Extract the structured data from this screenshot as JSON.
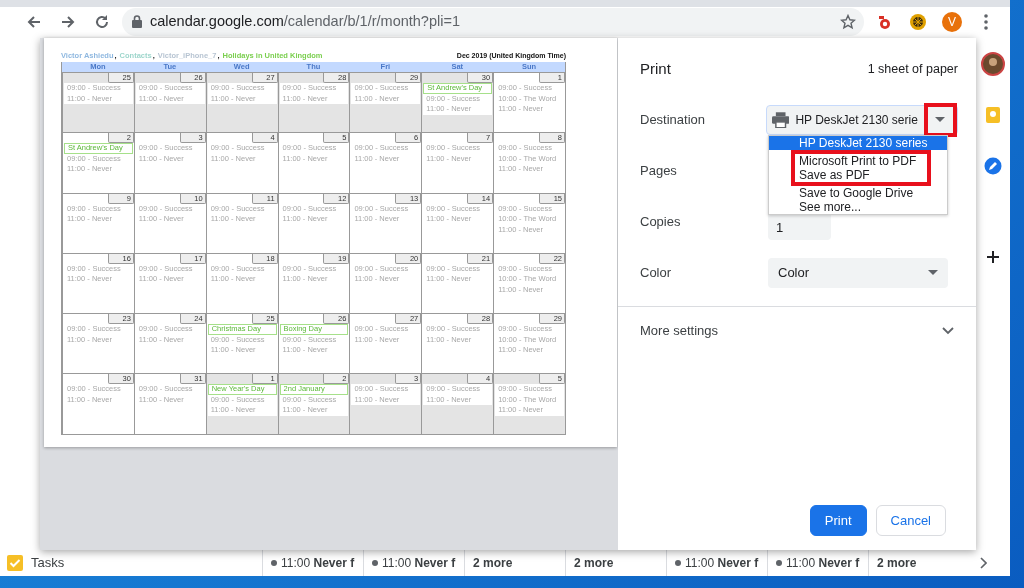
{
  "browser": {
    "url_host": "calendar.google.com",
    "url_path": "/calendar/b/1/r/month?pli=1",
    "avatar": "V"
  },
  "preview": {
    "calendars": [
      {
        "name": "Victor Ashiedu",
        "color": "#8fb8e0",
        "separator": ","
      },
      {
        "name": "Contacts",
        "color": "#9ed6cc",
        "separator": ","
      },
      {
        "name": "Victor_iPhone_7",
        "color": "#b7c4d2",
        "separator": ","
      },
      {
        "name": "Holidays in United Kingdom",
        "color": "#7bcf4f"
      }
    ],
    "title": "Dec 2019 (United Kingdom Time)",
    "weekdays": [
      "Mon",
      "Tue",
      "Wed",
      "Thu",
      "Fri",
      "Sat",
      "Sun"
    ],
    "days": [
      {
        "date": "25",
        "outside": true,
        "events": [
          {
            "kind": "entry",
            "text": "09:00 - Success"
          },
          {
            "kind": "entry",
            "text": "11:00 - Never"
          }
        ]
      },
      {
        "date": "26",
        "outside": true,
        "events": [
          {
            "kind": "entry",
            "text": "09:00 - Success"
          },
          {
            "kind": "entry",
            "text": "11:00 - Never"
          }
        ]
      },
      {
        "date": "27",
        "outside": true,
        "events": [
          {
            "kind": "entry",
            "text": "09:00 - Success"
          },
          {
            "kind": "entry",
            "text": "11:00 - Never"
          }
        ]
      },
      {
        "date": "28",
        "outside": true,
        "events": [
          {
            "kind": "entry",
            "text": "09:00 - Success"
          },
          {
            "kind": "entry",
            "text": "11:00 - Never"
          }
        ]
      },
      {
        "date": "29",
        "outside": true,
        "events": [
          {
            "kind": "entry",
            "text": "09:00 - Success"
          },
          {
            "kind": "entry",
            "text": "11:00 - Never"
          }
        ]
      },
      {
        "date": "30",
        "outside": true,
        "events": [
          {
            "kind": "holiday",
            "text": "St Andrew's Day"
          },
          {
            "kind": "entry",
            "text": "09:00 - Success"
          },
          {
            "kind": "entry",
            "text": "11:00 - Never"
          }
        ]
      },
      {
        "date": "1",
        "outside": false,
        "events": [
          {
            "kind": "entry",
            "text": "09:00 - Success"
          },
          {
            "kind": "entry",
            "text": "10:00 - The Word"
          },
          {
            "kind": "entry",
            "text": "11:00 - Never"
          }
        ]
      },
      {
        "date": "2",
        "outside": false,
        "events": [
          {
            "kind": "holiday",
            "text": "St Andrew's Day"
          },
          {
            "kind": "entry",
            "text": "09:00 - Success"
          },
          {
            "kind": "entry",
            "text": "11:00 - Never"
          }
        ]
      },
      {
        "date": "3",
        "outside": false,
        "events": [
          {
            "kind": "entry",
            "text": "09:00 - Success"
          },
          {
            "kind": "entry",
            "text": "11:00 - Never"
          }
        ]
      },
      {
        "date": "4",
        "outside": false,
        "events": [
          {
            "kind": "entry",
            "text": "09:00 - Success"
          },
          {
            "kind": "entry",
            "text": "11:00 - Never"
          }
        ]
      },
      {
        "date": "5",
        "outside": false,
        "events": [
          {
            "kind": "entry",
            "text": "09:00 - Success"
          },
          {
            "kind": "entry",
            "text": "11:00 - Never"
          }
        ]
      },
      {
        "date": "6",
        "outside": false,
        "events": [
          {
            "kind": "entry",
            "text": "09:00 - Success"
          },
          {
            "kind": "entry",
            "text": "11:00 - Never"
          }
        ]
      },
      {
        "date": "7",
        "outside": false,
        "events": [
          {
            "kind": "entry",
            "text": "09:00 - Success"
          },
          {
            "kind": "entry",
            "text": "11:00 - Never"
          }
        ]
      },
      {
        "date": "8",
        "outside": false,
        "events": [
          {
            "kind": "entry",
            "text": "09:00 - Success"
          },
          {
            "kind": "entry",
            "text": "10:00 - The Word"
          },
          {
            "kind": "entry",
            "text": "11:00 - Never"
          }
        ]
      },
      {
        "date": "9",
        "outside": false,
        "events": [
          {
            "kind": "entry",
            "text": "09:00 - Success"
          },
          {
            "kind": "entry",
            "text": "11:00 - Never"
          }
        ]
      },
      {
        "date": "10",
        "outside": false,
        "events": [
          {
            "kind": "entry",
            "text": "09:00 - Success"
          },
          {
            "kind": "entry",
            "text": "11:00 - Never"
          }
        ]
      },
      {
        "date": "11",
        "outside": false,
        "events": [
          {
            "kind": "entry",
            "text": "09:00 - Success"
          },
          {
            "kind": "entry",
            "text": "11:00 - Never"
          }
        ]
      },
      {
        "date": "12",
        "outside": false,
        "events": [
          {
            "kind": "entry",
            "text": "09:00 - Success"
          },
          {
            "kind": "entry",
            "text": "11:00 - Never"
          }
        ]
      },
      {
        "date": "13",
        "outside": false,
        "events": [
          {
            "kind": "entry",
            "text": "09:00 - Success"
          },
          {
            "kind": "entry",
            "text": "11:00 - Never"
          }
        ]
      },
      {
        "date": "14",
        "outside": false,
        "events": [
          {
            "kind": "entry",
            "text": "09:00 - Success"
          },
          {
            "kind": "entry",
            "text": "11:00 - Never"
          }
        ]
      },
      {
        "date": "15",
        "outside": false,
        "events": [
          {
            "kind": "entry",
            "text": "09:00 - Success"
          },
          {
            "kind": "entry",
            "text": "10:00 - The Word"
          },
          {
            "kind": "entry",
            "text": "11:00 - Never"
          }
        ]
      },
      {
        "date": "16",
        "outside": false,
        "events": [
          {
            "kind": "entry",
            "text": "09:00 - Success"
          },
          {
            "kind": "entry",
            "text": "11:00 - Never"
          }
        ]
      },
      {
        "date": "17",
        "outside": false,
        "events": [
          {
            "kind": "entry",
            "text": "09:00 - Success"
          },
          {
            "kind": "entry",
            "text": "11:00 - Never"
          }
        ]
      },
      {
        "date": "18",
        "outside": false,
        "events": [
          {
            "kind": "entry",
            "text": "09:00 - Success"
          },
          {
            "kind": "entry",
            "text": "11:00 - Never"
          }
        ]
      },
      {
        "date": "19",
        "outside": false,
        "events": [
          {
            "kind": "entry",
            "text": "09:00 - Success"
          },
          {
            "kind": "entry",
            "text": "11:00 - Never"
          }
        ]
      },
      {
        "date": "20",
        "outside": false,
        "events": [
          {
            "kind": "entry",
            "text": "09:00 - Success"
          },
          {
            "kind": "entry",
            "text": "11:00 - Never"
          }
        ]
      },
      {
        "date": "21",
        "outside": false,
        "events": [
          {
            "kind": "entry",
            "text": "09:00 - Success"
          },
          {
            "kind": "entry",
            "text": "11:00 - Never"
          }
        ]
      },
      {
        "date": "22",
        "outside": false,
        "events": [
          {
            "kind": "entry",
            "text": "09:00 - Success"
          },
          {
            "kind": "entry",
            "text": "10:00 - The Word"
          },
          {
            "kind": "entry",
            "text": "11:00 - Never"
          }
        ]
      },
      {
        "date": "23",
        "outside": false,
        "events": [
          {
            "kind": "entry",
            "text": "09:00 - Success"
          },
          {
            "kind": "entry",
            "text": "11:00 - Never"
          }
        ]
      },
      {
        "date": "24",
        "outside": false,
        "events": [
          {
            "kind": "entry",
            "text": "09:00 - Success"
          },
          {
            "kind": "entry",
            "text": "11:00 - Never"
          }
        ]
      },
      {
        "date": "25",
        "outside": false,
        "events": [
          {
            "kind": "holiday",
            "text": "Christmas Day"
          },
          {
            "kind": "entry",
            "text": "09:00 - Success"
          },
          {
            "kind": "entry",
            "text": "11:00 - Never"
          }
        ]
      },
      {
        "date": "26",
        "outside": false,
        "events": [
          {
            "kind": "holiday",
            "text": "Boxing Day"
          },
          {
            "kind": "entry",
            "text": "09:00 - Success"
          },
          {
            "kind": "entry",
            "text": "11:00 - Never"
          }
        ]
      },
      {
        "date": "27",
        "outside": false,
        "events": [
          {
            "kind": "entry",
            "text": "09:00 - Success"
          },
          {
            "kind": "entry",
            "text": "11:00 - Never"
          }
        ]
      },
      {
        "date": "28",
        "outside": false,
        "events": [
          {
            "kind": "entry",
            "text": "09:00 - Success"
          },
          {
            "kind": "entry",
            "text": "11:00 - Never"
          }
        ]
      },
      {
        "date": "29",
        "outside": false,
        "events": [
          {
            "kind": "entry",
            "text": "09:00 - Success"
          },
          {
            "kind": "entry",
            "text": "10:00 - The Word"
          },
          {
            "kind": "entry",
            "text": "11:00 - Never"
          }
        ]
      },
      {
        "date": "30",
        "outside": false,
        "events": [
          {
            "kind": "entry",
            "text": "09:00 - Success"
          },
          {
            "kind": "entry",
            "text": "11:00 - Never"
          }
        ]
      },
      {
        "date": "31",
        "outside": false,
        "events": [
          {
            "kind": "entry",
            "text": "09:00 - Success"
          },
          {
            "kind": "entry",
            "text": "11:00 - Never"
          }
        ]
      },
      {
        "date": "1",
        "outside": true,
        "events": [
          {
            "kind": "holiday",
            "text": "New Year's Day"
          },
          {
            "kind": "entry",
            "text": "09:00 - Success"
          },
          {
            "kind": "entry",
            "text": "11:00 - Never"
          }
        ]
      },
      {
        "date": "2",
        "outside": true,
        "events": [
          {
            "kind": "holiday",
            "text": "2nd January"
          },
          {
            "kind": "entry",
            "text": "09:00 - Success"
          },
          {
            "kind": "entry",
            "text": "11:00 - Never"
          }
        ]
      },
      {
        "date": "3",
        "outside": true,
        "events": [
          {
            "kind": "entry",
            "text": "09:00 - Success"
          },
          {
            "kind": "entry",
            "text": "11:00 - Never"
          }
        ]
      },
      {
        "date": "4",
        "outside": true,
        "events": [
          {
            "kind": "entry",
            "text": "09:00 - Success"
          },
          {
            "kind": "entry",
            "text": "11:00 - Never"
          }
        ]
      },
      {
        "date": "5",
        "outside": true,
        "events": [
          {
            "kind": "entry",
            "text": "09:00 - Success"
          },
          {
            "kind": "entry",
            "text": "10:00 - The Word"
          },
          {
            "kind": "entry",
            "text": "11:00 - Never"
          }
        ]
      }
    ]
  },
  "print": {
    "title": "Print",
    "sheets": "1 sheet of paper",
    "destination": {
      "label": "Destination",
      "value": "HP DeskJet 2130 serie",
      "caret_highlighted": true,
      "options": [
        {
          "text": "HP DeskJet 2130 series",
          "selected": true,
          "highlighted": false
        },
        {
          "text": "Microsoft Print to PDF",
          "selected": false,
          "highlighted": true
        },
        {
          "text": "Save as PDF",
          "selected": false,
          "highlighted": true
        },
        {
          "text": "Save to Google Drive",
          "selected": false,
          "highlighted": false
        },
        {
          "text": "See more...",
          "selected": false,
          "highlighted": false
        }
      ]
    },
    "pages": {
      "label": "Pages"
    },
    "copies": {
      "label": "Copies",
      "value": "1"
    },
    "color": {
      "label": "Color",
      "value": "Color"
    },
    "more_settings": "More settings",
    "buttons": [
      {
        "text": "Print",
        "kind": "primary"
      },
      {
        "text": "Cancel",
        "kind": "secondary"
      }
    ]
  },
  "tasks": {
    "label": "Tasks",
    "checked": true,
    "cells": [
      {
        "kind": "event",
        "text": "11:00 **Never f**"
      },
      {
        "kind": "event",
        "text": "11:00 **Never f**"
      },
      {
        "kind": "more",
        "text": "2 more"
      },
      {
        "kind": "more",
        "text": "2 more"
      },
      {
        "kind": "event",
        "text": "11:00 **Never f**"
      },
      {
        "kind": "event",
        "text": "11:00 **Never f**"
      },
      {
        "kind": "more",
        "text": "2 more"
      }
    ]
  }
}
